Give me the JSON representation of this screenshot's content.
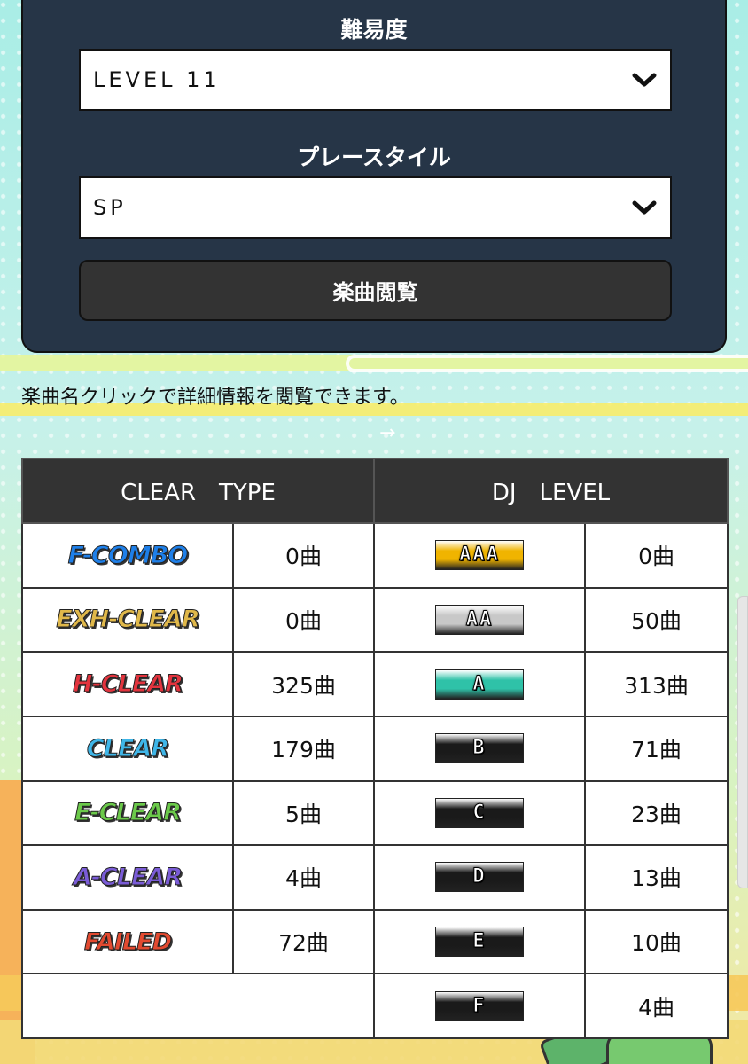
{
  "filter": {
    "difficulty_label": "難易度",
    "difficulty_value": "LEVEL 11",
    "playstyle_label": "プレースタイル",
    "playstyle_value": "SP",
    "browse_button_label": "楽曲閲覧"
  },
  "note": "楽曲名クリックで詳細情報を閲覧できます。",
  "table": {
    "clear_type_header": "CLEAR　TYPE",
    "dj_level_header": "DJ　LEVEL",
    "clear_types": [
      {
        "label": "F-COMBO",
        "count": "0曲",
        "color": "#1e7fe8"
      },
      {
        "label": "EXH-CLEAR",
        "count": "0曲",
        "color": "#e0b84a"
      },
      {
        "label": "H-CLEAR",
        "count": "325曲",
        "color": "#e2343e"
      },
      {
        "label": "CLEAR",
        "count": "179曲",
        "color": "#3fb6e8"
      },
      {
        "label": "E-CLEAR",
        "count": "5曲",
        "color": "#6bc94a"
      },
      {
        "label": "A-CLEAR",
        "count": "4曲",
        "color": "#7a5cd6"
      },
      {
        "label": "FAILED",
        "count": "72曲",
        "color": "#e24a30"
      }
    ],
    "dj_levels": [
      {
        "label": "AAA",
        "count": "0曲",
        "color": "#f0b400"
      },
      {
        "label": "AA",
        "count": "50曲",
        "color": "#c8c8c8"
      },
      {
        "label": "A",
        "count": "313曲",
        "color": "#2fc2a8"
      },
      {
        "label": "B",
        "count": "71曲",
        "color": "#1a1a1a"
      },
      {
        "label": "C",
        "count": "23曲",
        "color": "#1a1a1a"
      },
      {
        "label": "D",
        "count": "13曲",
        "color": "#1a1a1a"
      },
      {
        "label": "E",
        "count": "10曲",
        "color": "#1a1a1a"
      },
      {
        "label": "F",
        "count": "4曲",
        "color": "#1a1a1a"
      }
    ]
  }
}
